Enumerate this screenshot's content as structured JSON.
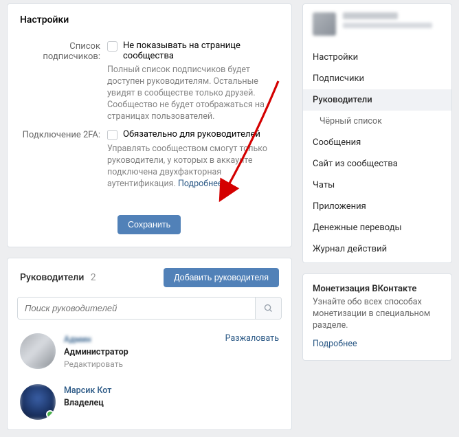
{
  "colors": {
    "primary": "#5181b8",
    "link": "#2a5885"
  },
  "settings": {
    "title": "Настройки",
    "subscribers": {
      "label": "Список подписчиков:",
      "checkbox_label": "Не показывать на странице сообщества",
      "description": "Полный список подписчиков будет доступен руководителям. Остальные увидят в сообществе только друзей. Сообщество не будет отображаться на страницах пользователей."
    },
    "two_fa": {
      "label": "Подключение 2FA:",
      "checkbox_label": "Обязательно для руководителей",
      "description": "Управлять сообществом смогут только руководители, у которых в аккаунте подключена двухфакторная аутентификация.",
      "more_link": "Подробнее"
    },
    "save_button": "Сохранить"
  },
  "managers": {
    "title": "Руководители",
    "count": "2",
    "add_button": "Добавить руководителя",
    "search_placeholder": "Поиск руководителей",
    "demote_label": "Разжаловать",
    "items": [
      {
        "name": "Админ",
        "role": "Администратор",
        "edit": "Редактировать",
        "demotable": true
      },
      {
        "name": "Марсик Кот",
        "role": "Владелец",
        "edit": "",
        "demotable": false
      }
    ]
  },
  "sidebar": {
    "items": [
      {
        "label": "Настройки",
        "active": false
      },
      {
        "label": "Подписчики",
        "active": false
      },
      {
        "label": "Руководители",
        "active": true
      },
      {
        "label": "Чёрный список",
        "active": false,
        "dim": true
      },
      {
        "label": "Сообщения",
        "active": false
      },
      {
        "label": "Сайт из сообщества",
        "active": false
      },
      {
        "label": "Чаты",
        "active": false
      },
      {
        "label": "Приложения",
        "active": false
      },
      {
        "label": "Денежные переводы",
        "active": false
      },
      {
        "label": "Журнал действий",
        "active": false
      }
    ]
  },
  "monetization": {
    "title": "Монетизация ВКонтакте",
    "description": "Узнайте обо всех способах монетизации в специальном разделе.",
    "link": "Подробнее"
  }
}
